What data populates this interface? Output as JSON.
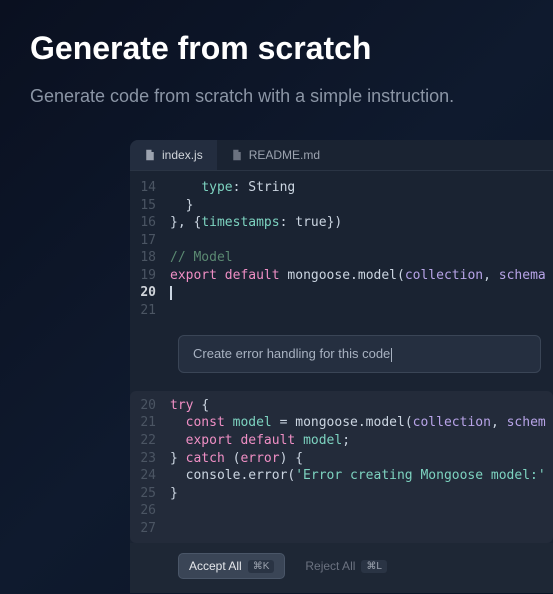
{
  "header": {
    "title": "Generate from scratch",
    "subtitle": "Generate code from scratch with a simple instruction."
  },
  "tabs": [
    {
      "label": "index.js",
      "active": true
    },
    {
      "label": "README.md",
      "active": false
    }
  ],
  "code_top": [
    {
      "num": "14",
      "tokens": [
        [
          "    ",
          ""
        ],
        [
          "type",
          "prop"
        ],
        [
          ": ",
          ""
        ],
        [
          "String",
          "type"
        ]
      ]
    },
    {
      "num": "15",
      "tokens": [
        [
          "  }",
          ""
        ]
      ]
    },
    {
      "num": "16",
      "tokens": [
        [
          "}, {",
          ""
        ],
        [
          "timestamps",
          "prop"
        ],
        [
          ": ",
          ""
        ],
        [
          "true",
          "bool"
        ],
        [
          "})",
          ""
        ]
      ]
    },
    {
      "num": "17",
      "tokens": [
        [
          "",
          ""
        ]
      ]
    },
    {
      "num": "18",
      "tokens": [
        [
          "// Model",
          "comment"
        ]
      ]
    },
    {
      "num": "19",
      "tokens": [
        [
          "export ",
          "kw"
        ],
        [
          "default ",
          "default"
        ],
        [
          "mongoose.model(",
          ""
        ],
        [
          "collection",
          "ident"
        ],
        [
          ", ",
          ""
        ],
        [
          "schema",
          "ident"
        ]
      ]
    },
    {
      "num": "20",
      "tokens": [],
      "cursor": true
    },
    {
      "num": "21",
      "tokens": [
        [
          "",
          ""
        ]
      ]
    }
  ],
  "prompt": {
    "text": "Create error handling for this code"
  },
  "code_suggestion": [
    {
      "num": "20",
      "tokens": [
        [
          "try ",
          "kw"
        ],
        [
          "{",
          ""
        ]
      ]
    },
    {
      "num": "21",
      "tokens": [
        [
          "  ",
          ""
        ],
        [
          "const ",
          "kw"
        ],
        [
          "model",
          "var"
        ],
        [
          " = mongoose.model(",
          ""
        ],
        [
          "collection",
          "ident"
        ],
        [
          ", ",
          ""
        ],
        [
          "schem",
          "ident"
        ]
      ]
    },
    {
      "num": "22",
      "tokens": [
        [
          "  ",
          ""
        ],
        [
          "export ",
          "kw"
        ],
        [
          "default ",
          "default"
        ],
        [
          "model",
          "var"
        ],
        [
          ";",
          ""
        ]
      ]
    },
    {
      "num": "23",
      "tokens": [
        [
          "} ",
          ""
        ],
        [
          "catch ",
          "kw"
        ],
        [
          "(",
          ""
        ],
        [
          "error",
          "err"
        ],
        [
          ") {",
          ""
        ]
      ]
    },
    {
      "num": "24",
      "tokens": [
        [
          "  console.error(",
          ""
        ],
        [
          "'Error creating Mongoose model:'",
          "str"
        ]
      ]
    },
    {
      "num": "25",
      "tokens": [
        [
          "}",
          ""
        ]
      ]
    },
    {
      "num": "26",
      "tokens": [
        [
          "",
          ""
        ]
      ]
    },
    {
      "num": "27",
      "tokens": [
        [
          "",
          ""
        ]
      ]
    }
  ],
  "actions": {
    "accept": {
      "label": "Accept All",
      "kbd": "⌘K"
    },
    "reject": {
      "label": "Reject All",
      "kbd": "⌘L"
    }
  }
}
